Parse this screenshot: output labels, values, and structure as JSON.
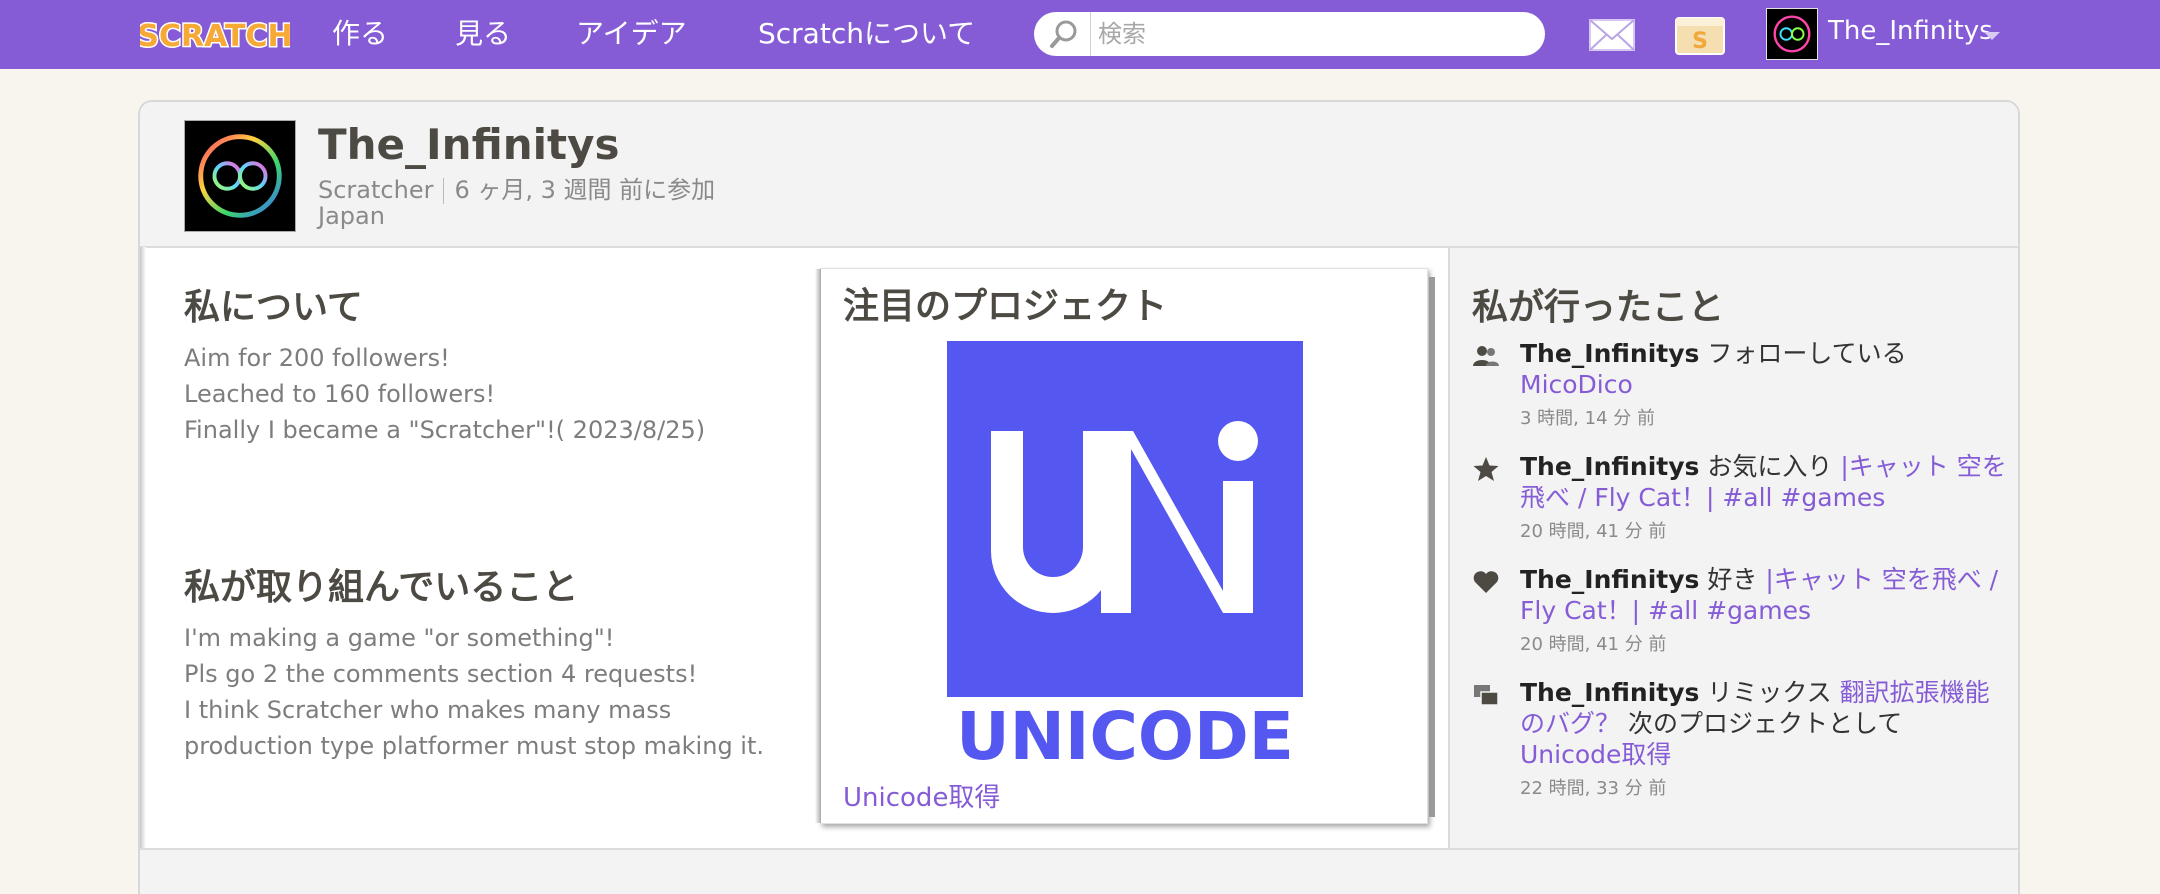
{
  "nav": {
    "logo_text": "SCRATCH",
    "items": [
      {
        "label": "作る"
      },
      {
        "label": "見る"
      },
      {
        "label": "アイデア"
      },
      {
        "label": "Scratchについて"
      }
    ],
    "search_placeholder": "検索",
    "message_icon": "envelope-icon",
    "mystuff_icon": "folder-icon",
    "account_name": "The_Infinitys"
  },
  "profile": {
    "username": "The_Infinitys",
    "role": "Scratcher",
    "joined": "6 ヶ月, 3 週間 前に参加",
    "country": "Japan"
  },
  "about": {
    "title": "私について",
    "lines": [
      "Aim for 200 followers!",
      "Leached to 160 followers!",
      "Finally I became a \"Scratcher\"!( 2023/8/25)"
    ]
  },
  "working_on": {
    "title": "私が取り組んでいること",
    "lines": [
      "I'm making a game \"or something\"!",
      "Pls go 2 the comments section 4 requests!",
      "I think Scratcher who makes many mass",
      "production type platformer must stop making it."
    ]
  },
  "featured": {
    "title": "注目のプロジェクト",
    "project_title": "Unicode取得",
    "thumb_wordmark": "UNICODE",
    "thumb_color": "#5457f0"
  },
  "activity": {
    "title": "私が行ったこと",
    "items": [
      {
        "icon": "followers-icon",
        "user": "The_Infinitys",
        "action": "フォローしている",
        "target": "MicoDico",
        "time": "3 時間, 14 分 前"
      },
      {
        "icon": "star-icon",
        "user": "The_Infinitys",
        "action": "お気に入り",
        "target": "|キャット 空を飛べ / Fly Cat！| #all #games",
        "time": "20 時間, 41 分 前"
      },
      {
        "icon": "heart-icon",
        "user": "The_Infinitys",
        "action": "好き",
        "target": "|キャット 空を飛べ / Fly Cat！| #all #games",
        "time": "20 時間, 41 分 前"
      },
      {
        "icon": "remix-icon",
        "user": "The_Infinitys",
        "action": "リミックス",
        "target": "翻訳拡張機能のバグ？",
        "middle": "次のプロジェクトとして",
        "target2": "Unicode取得",
        "time": "22 時間, 33 分 前"
      }
    ]
  },
  "colors": {
    "accent": "#855cd6",
    "background": "#f7f5ee"
  }
}
